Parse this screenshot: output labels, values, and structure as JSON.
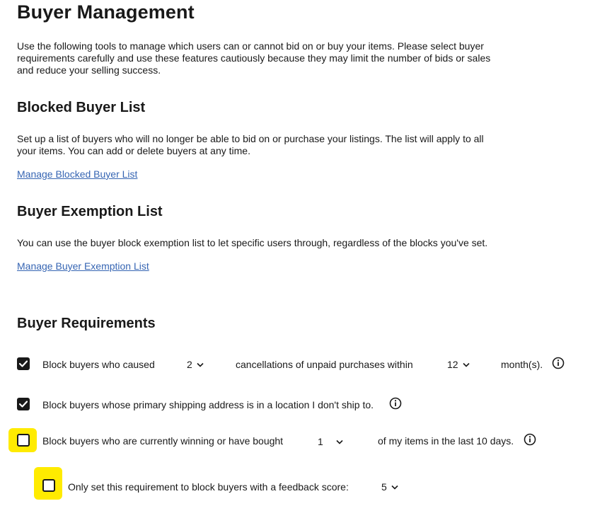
{
  "page": {
    "title": "Buyer Management",
    "intro": "Use the following tools to manage which users can or cannot bid on or buy your items. Please select buyer requirements carefully and use these features cautiously because they may limit the number of bids or sales and reduce your selling success."
  },
  "blocked_list": {
    "heading": "Blocked Buyer List",
    "description": "Set up a list of buyers who will no longer be able to bid on or purchase your listings. The list will apply to all your items. You can add or delete buyers at any time.",
    "link": "Manage Blocked Buyer List"
  },
  "exemption_list": {
    "heading": "Buyer Exemption List",
    "description": "You can use the buyer block exemption list to let specific users through, regardless of the blocks you've set.",
    "link": "Manage Buyer Exemption List"
  },
  "requirements": {
    "heading": "Buyer Requirements",
    "unpaid": {
      "checked": true,
      "label_pre": "Block buyers who caused",
      "count": "2",
      "label_mid": "cancellations of unpaid purchases within",
      "period": "12",
      "label_post": "month(s)."
    },
    "shipping": {
      "checked": true,
      "label": "Block buyers whose primary shipping address is in a location I don't ship to."
    },
    "winning": {
      "checked": false,
      "label_pre": "Block buyers who are currently winning or have bought",
      "count": "1",
      "label_post": "of my items in the last 10 days."
    },
    "feedback": {
      "checked": false,
      "label": "Only set this requirement to block buyers with a feedback score:",
      "score": "5"
    }
  },
  "icons": {
    "checkbox_checked": "checkmark-icon",
    "dropdown": "chevron-down-icon",
    "info": "info-icon"
  },
  "colors": {
    "link": "#3665b3",
    "highlight": "#ffeb00",
    "text": "#191919"
  }
}
